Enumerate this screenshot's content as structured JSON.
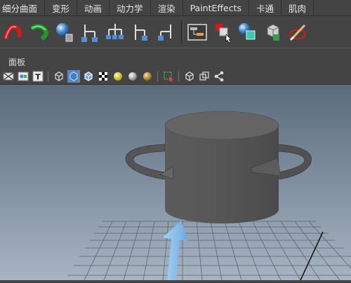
{
  "menubar": {
    "items": [
      "细分曲面",
      "变形",
      "动画",
      "动力学",
      "渲染",
      "PaintEffects",
      "卡通",
      "肌肉"
    ]
  },
  "shelf": {
    "icons": [
      "curve-red-icon",
      "curve-green-icon",
      "sphere-trash-icon",
      "hierarchy-1-icon",
      "hierarchy-2-icon",
      "hierarchy-3-icon",
      "hierarchy-4-icon",
      "hypergraph-icon",
      "cube-select-icon",
      "sphere-cube-icon",
      "cube-grid-icon",
      "paint-brush-icon"
    ]
  },
  "panel": {
    "menu_label": "面板"
  },
  "panel_toolbar": {
    "text_icon_label": "T"
  },
  "colors": {
    "ui_background": "#444444",
    "viewport_top": "#5a6b7d",
    "viewport_bottom": "#a7b4c2",
    "object_gray": "#575757",
    "arrow_blue": "#8ec1ee"
  }
}
